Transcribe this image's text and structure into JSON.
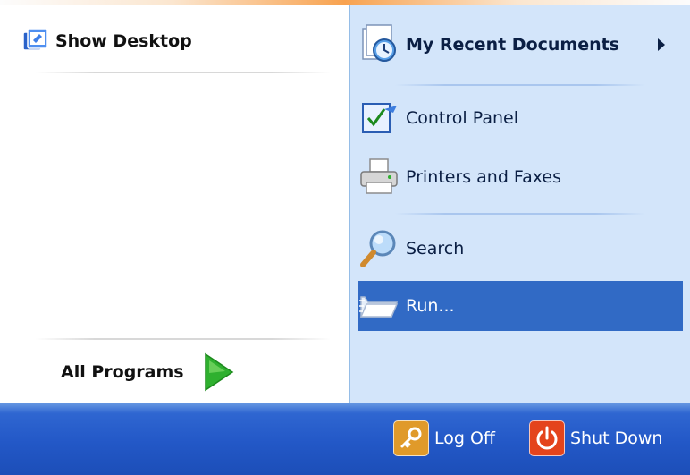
{
  "left_pane": {
    "show_desktop": {
      "label": "Show Desktop",
      "icon": "show-desktop-icon"
    },
    "all_programs": {
      "label": "All Programs",
      "icon": "green-arrow-icon"
    }
  },
  "right_pane": {
    "items": [
      {
        "label": "My Recent Documents",
        "icon": "recent-documents-icon",
        "bold": true,
        "submenu": true
      },
      {
        "label": "Control Panel",
        "icon": "control-panel-icon"
      },
      {
        "label": "Printers and Faxes",
        "icon": "printer-icon"
      },
      {
        "label": "Search",
        "icon": "search-magnifier-icon"
      },
      {
        "label": "Run...",
        "icon": "run-icon",
        "selected": true
      }
    ]
  },
  "bottom_bar": {
    "log_off": {
      "label": "Log Off",
      "icon": "key-icon"
    },
    "shut_down": {
      "label": "Shut Down",
      "icon": "power-icon"
    }
  },
  "colors": {
    "selection": "#316ac5",
    "right_pane_bg": "#d3e5fa",
    "bottom_bar": "#2358c7",
    "log_off_icon": "#e09a2a",
    "shut_down_icon": "#e4441c"
  }
}
